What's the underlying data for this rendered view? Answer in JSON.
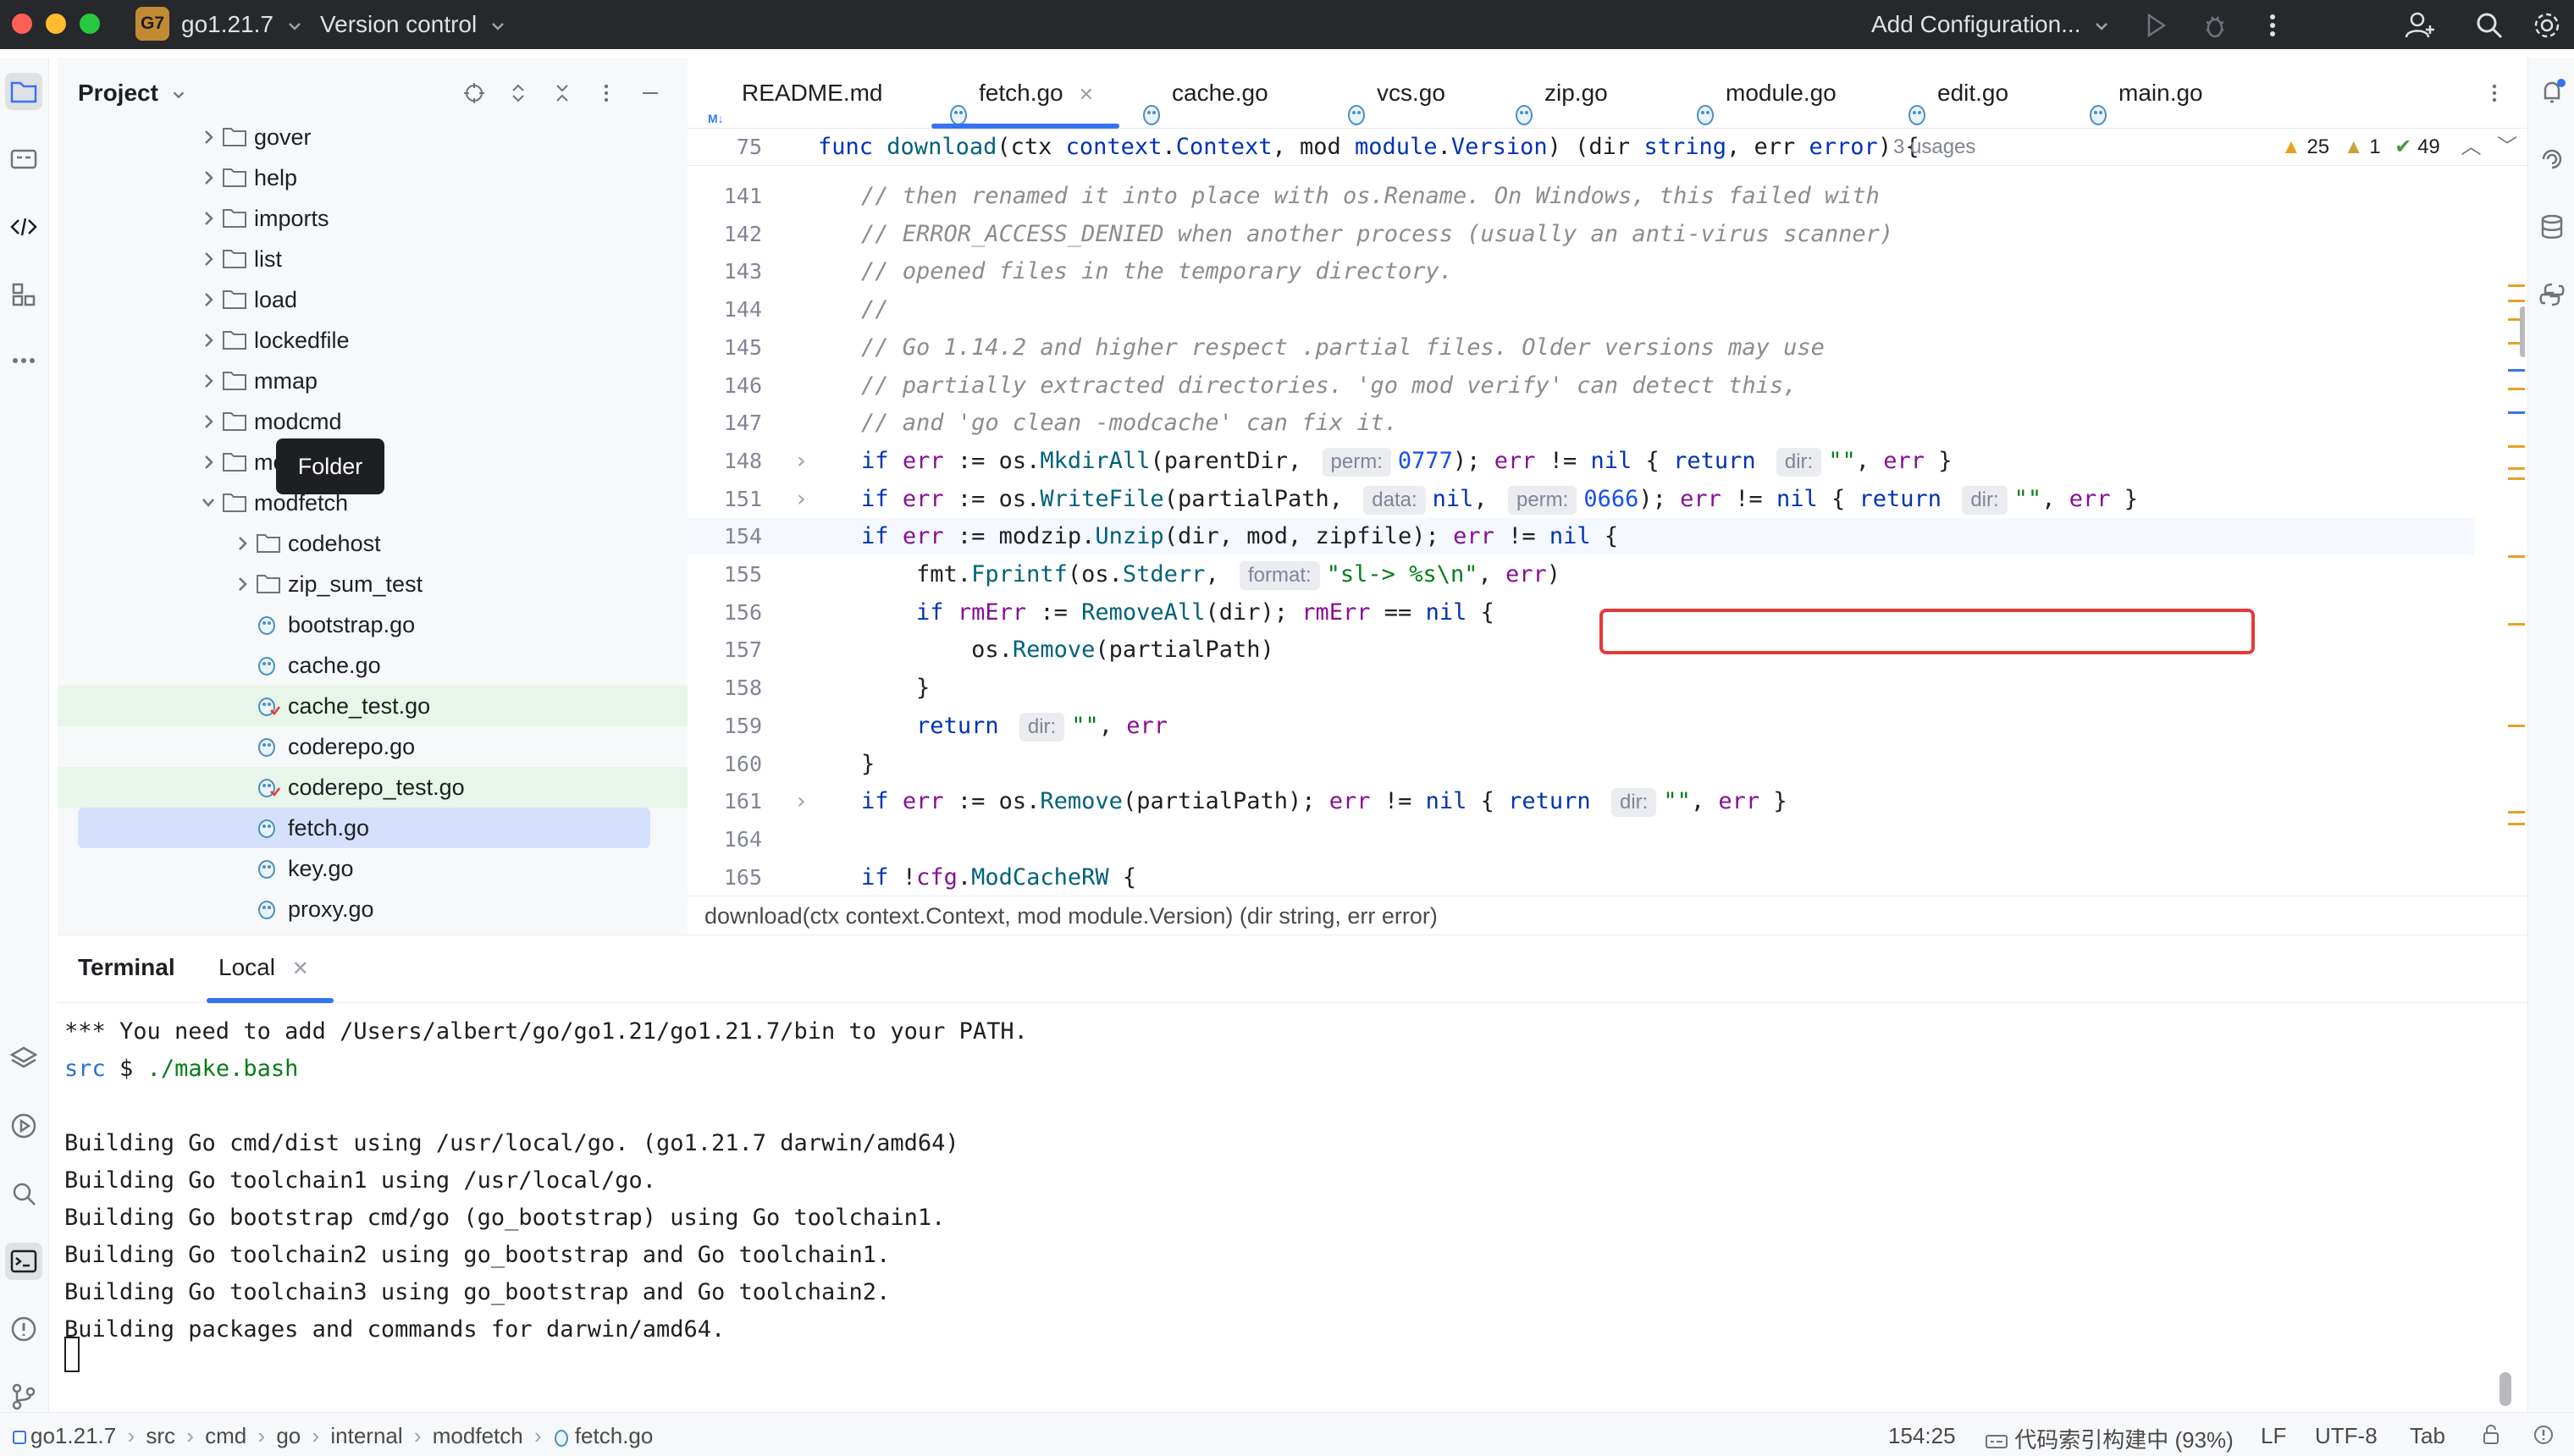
{
  "titlebar": {
    "project_badge": "G7",
    "project_name": "go1.21.7",
    "vcs": "Version control",
    "run_config": "Add Configuration...",
    "colors": {
      "bg": "#27282c",
      "badge": "#c28a34"
    }
  },
  "project_panel": {
    "title": "Project",
    "tree": [
      {
        "label": "gover",
        "type": "folder",
        "depth": 0,
        "state": "collapsed"
      },
      {
        "label": "help",
        "type": "folder",
        "depth": 0,
        "state": "collapsed"
      },
      {
        "label": "imports",
        "type": "folder",
        "depth": 0,
        "state": "collapsed"
      },
      {
        "label": "list",
        "type": "folder",
        "depth": 0,
        "state": "collapsed"
      },
      {
        "label": "load",
        "type": "folder",
        "depth": 0,
        "state": "collapsed"
      },
      {
        "label": "lockedfile",
        "type": "folder",
        "depth": 0,
        "state": "collapsed"
      },
      {
        "label": "mmap",
        "type": "folder",
        "depth": 0,
        "state": "collapsed"
      },
      {
        "label": "modcmd",
        "type": "folder",
        "depth": 0,
        "state": "collapsed"
      },
      {
        "label": "modconv",
        "type": "folder",
        "depth": 0,
        "state": "collapsed",
        "obscured": true
      },
      {
        "label": "modfetch",
        "type": "folder",
        "depth": 0,
        "state": "expanded"
      },
      {
        "label": "codehost",
        "type": "folder",
        "depth": 1,
        "state": "collapsed"
      },
      {
        "label": "zip_sum_test",
        "type": "folder",
        "depth": 1,
        "state": "collapsed"
      },
      {
        "label": "bootstrap.go",
        "type": "gofile",
        "depth": 1
      },
      {
        "label": "cache.go",
        "type": "gofile",
        "depth": 1
      },
      {
        "label": "cache_test.go",
        "type": "gotest",
        "depth": 1,
        "highlight": "green"
      },
      {
        "label": "coderepo.go",
        "type": "gofile",
        "depth": 1
      },
      {
        "label": "coderepo_test.go",
        "type": "gotest",
        "depth": 1,
        "highlight": "green"
      },
      {
        "label": "fetch.go",
        "type": "gofile",
        "depth": 1,
        "highlight": "selected"
      },
      {
        "label": "key.go",
        "type": "gofile",
        "depth": 1
      },
      {
        "label": "proxy.go",
        "type": "gofile",
        "depth": 1
      }
    ],
    "tooltip": "Folder"
  },
  "editor": {
    "tabs": [
      {
        "label": "README.md",
        "icon": "markdown-icon"
      },
      {
        "label": "fetch.go",
        "icon": "go-file-icon",
        "active": true,
        "closable": true
      },
      {
        "label": "cache.go",
        "icon": "go-file-icon"
      },
      {
        "label": "vcs.go",
        "icon": "go-file-icon"
      },
      {
        "label": "zip.go",
        "icon": "go-file-icon"
      },
      {
        "label": "module.go",
        "icon": "go-file-icon"
      },
      {
        "label": "edit.go",
        "icon": "go-file-icon"
      },
      {
        "label": "main.go",
        "icon": "go-file-icon"
      }
    ],
    "sticky": {
      "line": "75",
      "usages": "3 usages",
      "warnings": "25",
      "weak_warnings": "1",
      "checks": "49"
    },
    "lines": [
      {
        "n": "141",
        "code": "    // then renamed it into place with os.Rename. On Windows, this failed with"
      },
      {
        "n": "142",
        "code": "    // ERROR_ACCESS_DENIED when another process (usually an anti-virus scanner)"
      },
      {
        "n": "143",
        "code": "    // opened files in the temporary directory."
      },
      {
        "n": "144",
        "code": "    //"
      },
      {
        "n": "145",
        "code": "    // Go 1.14.2 and higher respect .partial files. Older versions may use"
      },
      {
        "n": "146",
        "code": "    // partially extracted directories. 'go mod verify' can detect this,"
      },
      {
        "n": "147",
        "code": "    // and 'go clean -modcache' can fix it."
      },
      {
        "n": "148",
        "code": "    if err := os.MkdirAll(parentDir, perm: 0777); err != nil { return dir: \"\", err }"
      },
      {
        "n": "151",
        "code": "    if err := os.WriteFile(partialPath, data: nil, perm: 0666); err != nil { return dir: \"\", err }"
      },
      {
        "n": "154",
        "code": "    if err := modzip.Unzip(dir, mod, zipfile); err != nil {"
      },
      {
        "n": "155",
        "code": "        fmt.Fprintf(os.Stderr, format: \"sl-> %s\\n\", err)"
      },
      {
        "n": "156",
        "code": "        if rmErr := RemoveAll(dir); rmErr == nil {"
      },
      {
        "n": "157",
        "code": "            os.Remove(partialPath)"
      },
      {
        "n": "158",
        "code": "        }"
      },
      {
        "n": "159",
        "code": "        return dir: \"\", err"
      },
      {
        "n": "160",
        "code": "    }"
      },
      {
        "n": "161",
        "code": "    if err := os.Remove(partialPath); err != nil { return dir: \"\", err }"
      },
      {
        "n": "164",
        "code": ""
      },
      {
        "n": "165",
        "code": "    if !cfg.ModCacheRW {"
      }
    ],
    "breadcrumb": "download(ctx context.Context, mod module.Version) (dir string, err error)"
  },
  "terminal": {
    "title": "Terminal",
    "tab": "Local",
    "lines": [
      "*** You need to add /Users/albert/go/go1.21/go1.21.7/bin to your PATH.",
      "",
      "",
      "Building Go cmd/dist using /usr/local/go. (go1.21.7 darwin/amd64)",
      "Building Go toolchain1 using /usr/local/go.",
      "Building Go bootstrap cmd/go (go_bootstrap) using Go toolchain1.",
      "Building Go toolchain2 using go_bootstrap and Go toolchain1.",
      "Building Go toolchain3 using go_bootstrap and Go toolchain2.",
      "Building packages and commands for darwin/amd64."
    ],
    "prompt_dir": "src",
    "prompt_symbol": "$",
    "prompt_cmd": "./make.bash"
  },
  "statusbar": {
    "crumbs": [
      "go1.21.7",
      "src",
      "cmd",
      "go",
      "internal",
      "modfetch",
      "fetch.go"
    ],
    "position": "154:25",
    "indexing": "代码索引构建中 (93%)",
    "line_sep": "LF",
    "encoding": "UTF-8",
    "indent": "Tab"
  }
}
